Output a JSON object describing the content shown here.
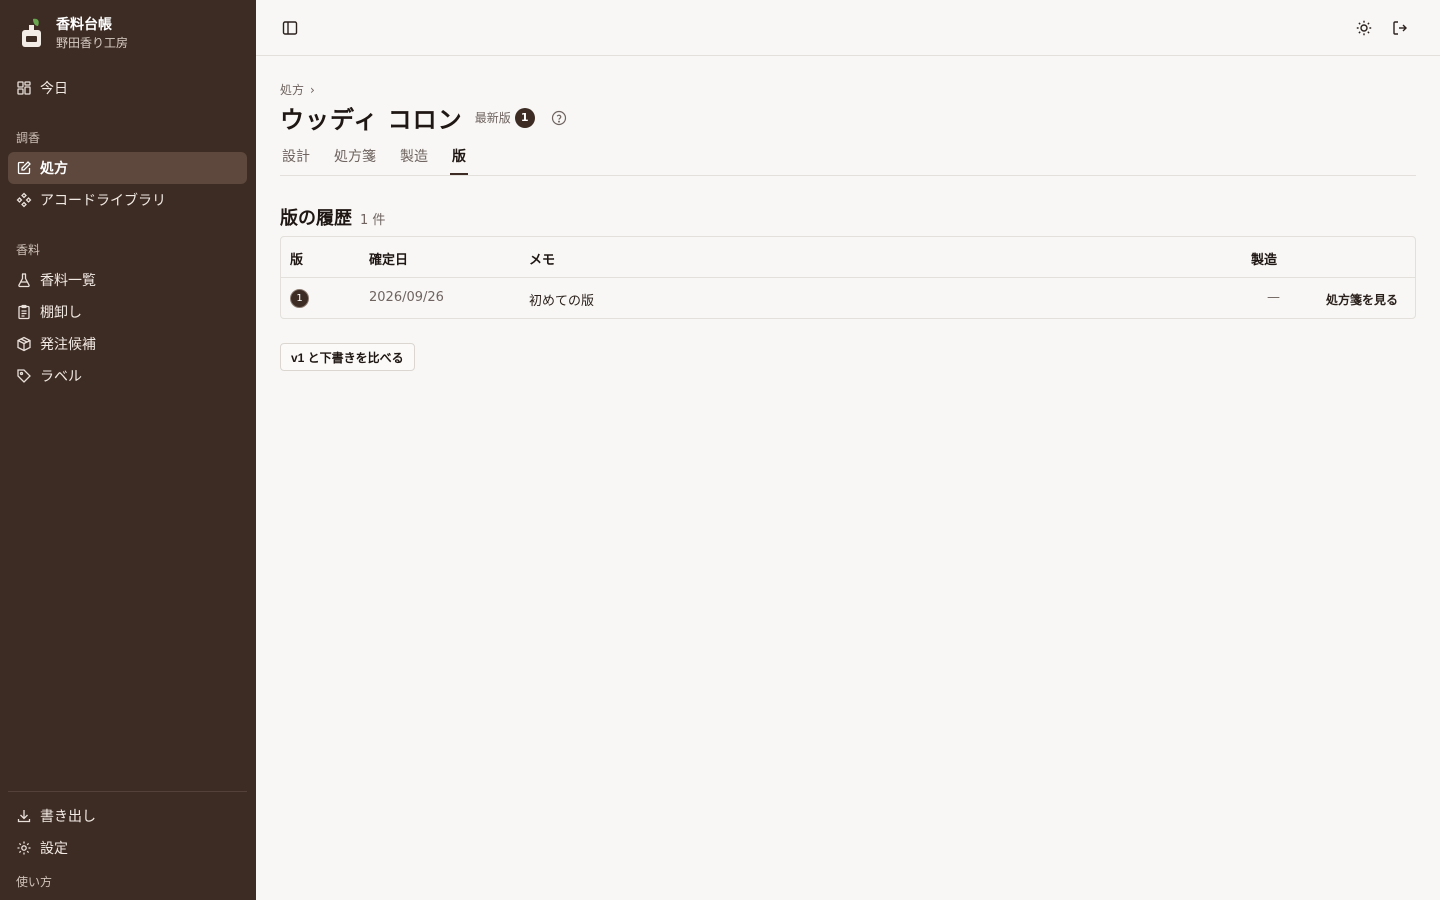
{
  "brand": {
    "title": "香料台帳",
    "subtitle": "野田香り工房"
  },
  "nav": {
    "today": "今日",
    "section_chouko": "調香",
    "recipes": "処方",
    "accord_library": "アコードライブラリ",
    "section_koryo": "香料",
    "materials": "香料一覧",
    "stocktake": "棚卸し",
    "order_candidates": "発注候補",
    "labels": "ラベル",
    "export": "書き出し",
    "settings": "設定",
    "howto": "使い方"
  },
  "topbar": {
    "icons": [
      "sidebar-toggle-icon",
      "sun-icon",
      "logout-icon"
    ]
  },
  "page": {
    "breadcrumb": "処方",
    "breadcrumb_sep": "›",
    "title": "ウッディ コロン",
    "version_label": "最新版",
    "version_number": "1"
  },
  "tabs": [
    "設計",
    "処方箋",
    "製造",
    "版"
  ],
  "active_tab": "版",
  "history": {
    "title": "版の履歴",
    "count": "1 件",
    "columns": [
      "版",
      "確定日",
      "メモ",
      "製造"
    ],
    "rows": [
      {
        "version": "1",
        "date": "2026/09/26",
        "memo": "初めての版",
        "production": "—",
        "action": "処方箋を見る"
      }
    ],
    "compare_button": "v1 と下書きを比べる"
  },
  "colors": {
    "sidebar_bg": "#3d2c24",
    "sidebar_active": "#5e473c",
    "page_bg": "#f8f7f5",
    "brand_leaf": "#6aa84f"
  }
}
